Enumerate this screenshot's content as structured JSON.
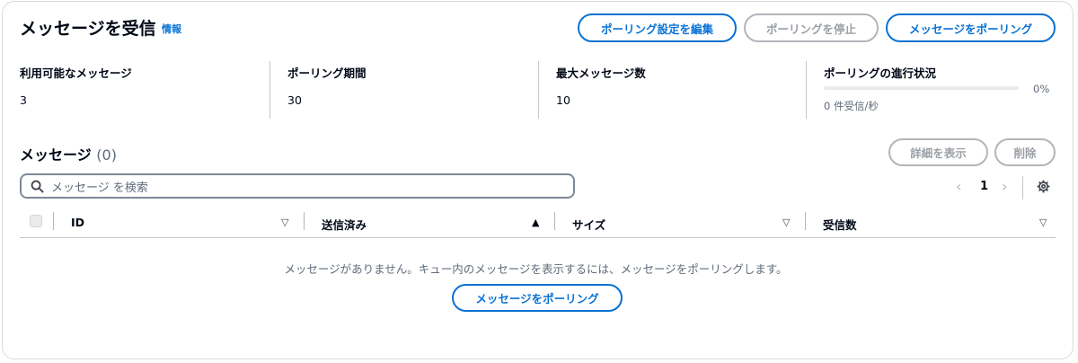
{
  "header": {
    "title": "メッセージを受信",
    "info_link": "情報",
    "buttons": {
      "edit_polling": "ポーリング設定を編集",
      "stop_polling": "ポーリングを停止",
      "poll_messages": "メッセージをポーリング"
    }
  },
  "stats": {
    "available": {
      "label": "利用可能なメッセージ",
      "value": "3"
    },
    "duration": {
      "label": "ポーリング期間",
      "value": "30"
    },
    "max_count": {
      "label": "最大メッセージ数",
      "value": "10"
    },
    "progress": {
      "label": "ポーリングの進行状況",
      "percent_text": "0%",
      "fraction": 0,
      "description": "0 件受信/秒"
    }
  },
  "messages": {
    "title": "メッセージ",
    "count": "(0)",
    "buttons": {
      "view_details": "詳細を表示",
      "delete": "削除"
    },
    "search": {
      "placeholder": "メッセージ を検索"
    },
    "pagination": {
      "current_page": "1"
    },
    "columns": [
      {
        "label": "ID",
        "sort": "▽"
      },
      {
        "label": "送信済み",
        "sort": "▲"
      },
      {
        "label": "サイズ",
        "sort": "▽"
      },
      {
        "label": "受信数",
        "sort": "▽"
      }
    ],
    "empty": {
      "text": "メッセージがありません。キュー内のメッセージを表示するには、メッセージをポーリングします。",
      "button": "メッセージをポーリング"
    }
  },
  "colors": {
    "accent": "#0972d3",
    "disabled": "#9ba0a6",
    "text": "#000716",
    "secondary_text": "#5f6b7a"
  },
  "icons": [
    "search-icon",
    "chevron-left-icon",
    "chevron-right-icon",
    "gear-icon",
    "sort-icon"
  ]
}
